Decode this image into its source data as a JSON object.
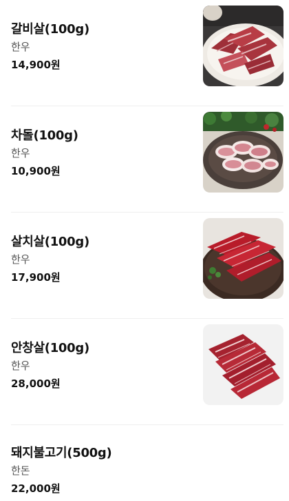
{
  "menu": {
    "items": [
      {
        "name": "갈비살(100g)",
        "origin": "한우",
        "price": "14,900원",
        "image": "marinated-galbisal-on-plate"
      },
      {
        "name": "차돌(100g)",
        "origin": "한우",
        "price": "10,900원",
        "image": "sliced-chadol-rolls-on-plate"
      },
      {
        "name": "살치살(100g)",
        "origin": "한우",
        "price": "17,900원",
        "image": "marbled-salchisal-on-board"
      },
      {
        "name": "안창살(100g)",
        "origin": "한우",
        "price": "28,000원",
        "image": "marbled-anchangsal-strips"
      },
      {
        "name": "돼지불고기(500g)",
        "origin": "한돈",
        "price": "22,000원"
      }
    ]
  }
}
